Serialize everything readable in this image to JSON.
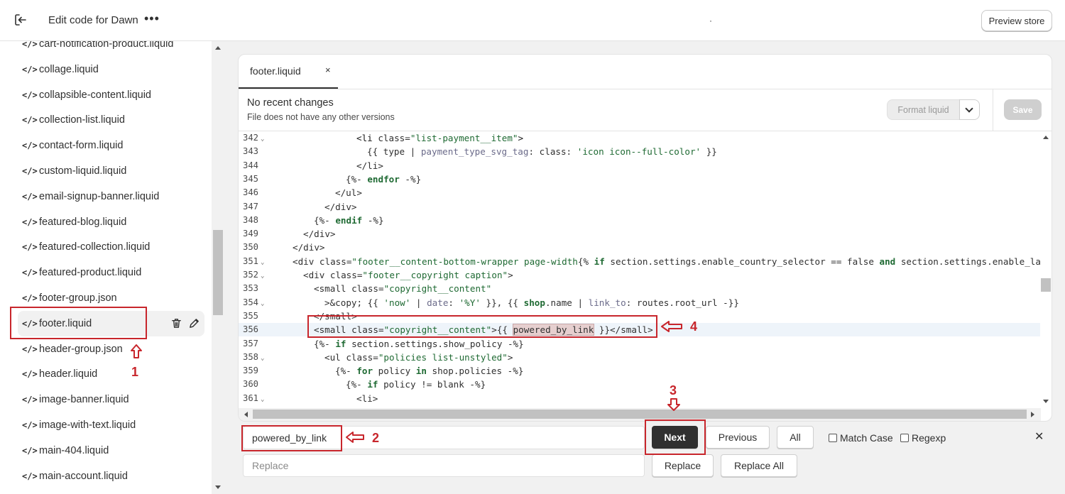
{
  "topbar": {
    "title": "Edit code for Dawn",
    "more": "•••",
    "dot": "·",
    "preview_label": "Preview store"
  },
  "sidebar": {
    "items": [
      {
        "name": "cart-notification-product.liquid"
      },
      {
        "name": "collage.liquid"
      },
      {
        "name": "collapsible-content.liquid"
      },
      {
        "name": "collection-list.liquid"
      },
      {
        "name": "contact-form.liquid"
      },
      {
        "name": "custom-liquid.liquid"
      },
      {
        "name": "email-signup-banner.liquid"
      },
      {
        "name": "featured-blog.liquid"
      },
      {
        "name": "featured-collection.liquid"
      },
      {
        "name": "featured-product.liquid"
      },
      {
        "name": "footer-group.json"
      },
      {
        "name": "footer.liquid",
        "active": true
      },
      {
        "name": "header-group.json"
      },
      {
        "name": "header.liquid"
      },
      {
        "name": "image-banner.liquid"
      },
      {
        "name": "image-with-text.liquid"
      },
      {
        "name": "main-404.liquid"
      },
      {
        "name": "main-account.liquid"
      }
    ],
    "file_icon": "</>"
  },
  "editor": {
    "tab_label": "footer.liquid",
    "tab_close": "×",
    "changes_title": "No recent changes",
    "changes_sub": "File does not have any other versions",
    "format_label": "Format liquid",
    "save_label": "Save"
  },
  "code_lines": [
    {
      "n": "342",
      "fold": true
    },
    {
      "n": "343"
    },
    {
      "n": "344"
    },
    {
      "n": "345"
    },
    {
      "n": "346"
    },
    {
      "n": "347"
    },
    {
      "n": "348"
    },
    {
      "n": "349"
    },
    {
      "n": "350"
    },
    {
      "n": "351",
      "fold": true
    },
    {
      "n": "352",
      "fold": true
    },
    {
      "n": "353"
    },
    {
      "n": "354",
      "fold": true
    },
    {
      "n": "355"
    },
    {
      "n": "356",
      "hl": true
    },
    {
      "n": "357"
    },
    {
      "n": "358",
      "fold": true
    },
    {
      "n": "359"
    },
    {
      "n": "360"
    },
    {
      "n": "361",
      "fold": true
    }
  ],
  "code_text": {
    "l342a": "<li ",
    "l342b": "class=",
    "l342c": "\"list-payment__item\"",
    "l342d": ">",
    "l343a": "{{ type | ",
    "l343b": "payment_type_svg_tag",
    "l343c": ": class: ",
    "l343d": "'icon icon--full-color'",
    "l343e": " }}",
    "l344": "</li>",
    "l345a": "{%- ",
    "l345b": "endfor",
    "l345c": " -%}",
    "l346": "</ul>",
    "l347": "</div>",
    "l348a": "{%- ",
    "l348b": "endif",
    "l348c": " -%}",
    "l349": "</div>",
    "l350": "</div>",
    "l351a": "<div ",
    "l351b": "class=",
    "l351c": "\"footer__content-bottom-wrapper page-width",
    "l351d": "{% ",
    "l351e": "if",
    "l351f": " section.settings.enable_country_selector == false ",
    "l351g": "and",
    "l351h": " section.settings.enable_la",
    "l352a": "<div ",
    "l352b": "class=",
    "l352c": "\"footer__copyright caption\"",
    "l352d": ">",
    "l353a": "<small ",
    "l353b": "class=",
    "l353c": "\"copyright__content\"",
    "l354a": ">&copy; {{ ",
    "l354b": "'now'",
    "l354c": " | ",
    "l354d": "date",
    "l354e": ": ",
    "l354f": "'%Y'",
    "l354g": " }}, {{ ",
    "l354h": "shop",
    "l354i": ".name | ",
    "l354j": "link_to",
    "l354k": ": routes.root_url -}}",
    "l355": "</small>",
    "l356a": "<small ",
    "l356b": "class=",
    "l356c": "\"copyright__content\"",
    "l356d": ">{{ ",
    "l356e": "powered_by_link",
    "l356f": " }}</small>",
    "l357a": "{%- ",
    "l357b": "if",
    "l357c": " section.settings.show_policy -%}",
    "l358a": "<ul ",
    "l358b": "class=",
    "l358c": "\"policies list-unstyled\"",
    "l358d": ">",
    "l359a": "{%- ",
    "l359b": "for",
    "l359c": " policy ",
    "l359d": "in",
    "l359e": " shop.policies -%}",
    "l360a": "{%- ",
    "l360b": "if",
    "l360c": " policy != blank -%}",
    "l361": "<li>"
  },
  "search": {
    "find_value": "powered_by_link",
    "replace_placeholder": "Replace",
    "next_label": "Next",
    "previous_label": "Previous",
    "all_label": "All",
    "match_case_label": "Match Case",
    "regexp_label": "Regexp",
    "replace_label": "Replace",
    "replace_all_label": "Replace All",
    "close": "✕"
  },
  "annotations": {
    "n1": "1",
    "n2": "2",
    "n3": "3",
    "n4": "4",
    "color": "#c8262c"
  }
}
